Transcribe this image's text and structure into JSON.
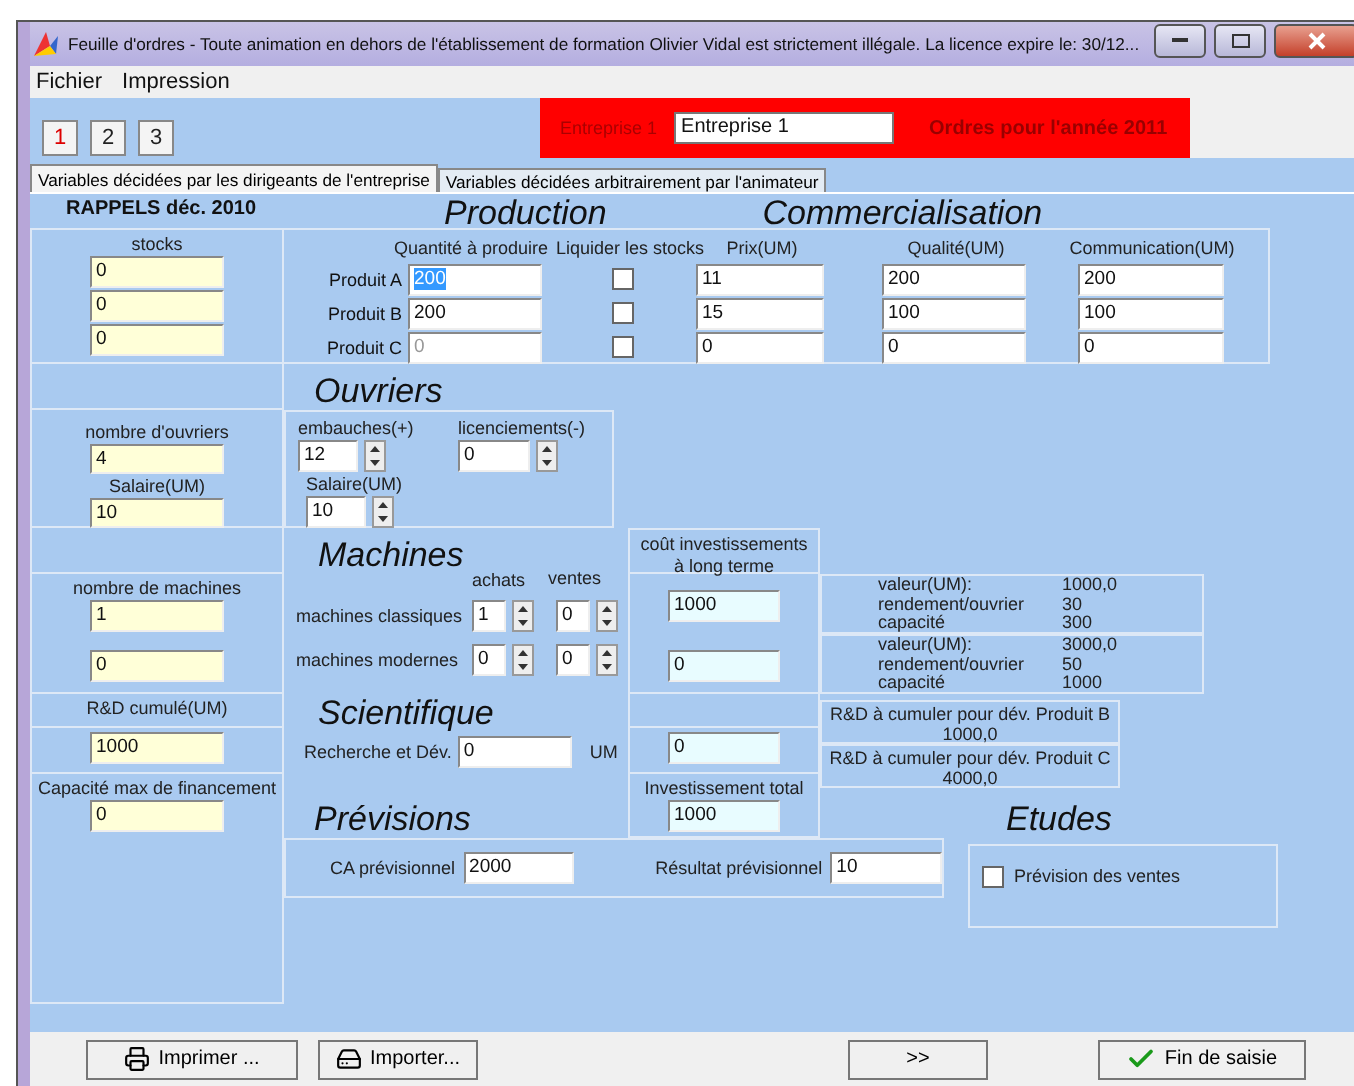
{
  "window": {
    "title": "Feuille d'ordres - Toute animation en dehors de l'établissement de formation Olivier Vidal est strictement illégale. La licence expire le: 30/12..."
  },
  "menu": [
    "Fichier",
    "Impression"
  ],
  "toolbar": {
    "buttons": [
      {
        "label": "1",
        "selected": true
      },
      {
        "label": "2",
        "selected": false
      },
      {
        "label": "3",
        "selected": false
      }
    ],
    "company_label": "Entreprise 1",
    "company_value": "Entreprise 1",
    "year_label": "Ordres pour l'année  2011"
  },
  "tabs": [
    {
      "label": "Variables décidées par les dirigeants de l'entreprise",
      "selected": true
    },
    {
      "label": "Variables décidées arbitrairement par l'animateur",
      "selected": false
    }
  ],
  "rappels": {
    "title": "RAPPELS déc. 2010",
    "stocks_label": "stocks",
    "stocks": [
      "0",
      "0",
      "0"
    ],
    "ouvriers_label": "nombre d'ouvriers",
    "ouvriers_value": "4",
    "salaire_label": "Salaire(UM)",
    "salaire_value": "10",
    "machines_label": "nombre de machines",
    "machines": [
      "1",
      "0"
    ],
    "rd_label": "R&D cumulé(UM)",
    "rd_value": "1000",
    "capacite_label": "Capacité max de financement",
    "capacite_value": "0"
  },
  "production": {
    "title": "Production",
    "quantity_header": "Quantité à produire",
    "liquidate_header": "Liquider les stocks",
    "rows": [
      {
        "product": "Produit A",
        "quantity": "200",
        "highlighted": true,
        "disabled": false,
        "liquidate": false,
        "price": "11",
        "quality": "200",
        "communication": "200"
      },
      {
        "product": "Produit B",
        "quantity": "200",
        "highlighted": false,
        "disabled": false,
        "liquidate": false,
        "price": "15",
        "quality": "100",
        "communication": "100"
      },
      {
        "product": "Produit C",
        "quantity": "0",
        "highlighted": false,
        "disabled": true,
        "liquidate": false,
        "price": "0",
        "quality": "0",
        "communication": "0"
      }
    ]
  },
  "commercialisation": {
    "title": "Commercialisation",
    "headers": [
      "Prix(UM)",
      "Qualité(UM)",
      "Communication(UM)"
    ]
  },
  "ouvriers": {
    "title": "Ouvriers",
    "embauches_label": "embauches(+)",
    "embauches_value": "12",
    "licenciements_label": "licenciements(-)",
    "licenciements_value": "0",
    "salaire_label": "Salaire(UM)",
    "salaire_value": "10"
  },
  "machines": {
    "title": "Machines",
    "achats_header": "achats",
    "ventes_header": "ventes",
    "cost_header": [
      "coût investissements",
      "à long terme"
    ],
    "rows": [
      {
        "label": "machines classiques",
        "achats": "1",
        "ventes": "0",
        "cost": "1000",
        "info": [
          {
            "label": "valeur(UM):",
            "value": "1000,0"
          },
          {
            "label": "rendement/ouvrier",
            "value": "30"
          },
          {
            "label": "capacité",
            "value": "300"
          }
        ]
      },
      {
        "label": "machines modernes",
        "achats": "0",
        "ventes": "0",
        "cost": "0",
        "info": [
          {
            "label": "valeur(UM):",
            "value": "3000,0"
          },
          {
            "label": "rendement/ouvrier",
            "value": "50"
          },
          {
            "label": "capacité",
            "value": "1000"
          }
        ]
      }
    ]
  },
  "scientifique": {
    "title": "Scientifique",
    "label": "Recherche et Dév.",
    "value": "0",
    "unit": "UM",
    "cost": "0",
    "targets": [
      {
        "label": "R&D à cumuler pour dév. Produit B",
        "value": "1000,0"
      },
      {
        "label": "R&D à cumuler pour dév. Produit C",
        "value": "4000,0"
      }
    ]
  },
  "investissement": {
    "label": "Investissement total",
    "value": "1000"
  },
  "previsions": {
    "title": "Prévisions",
    "ca_label": "CA prévisionnel",
    "ca_value": "2000",
    "resultat_label": "Résultat prévisionnel",
    "resultat_value": "10"
  },
  "etudes": {
    "title": "Etudes",
    "checkbox_label": "Prévision des ventes",
    "checked": false
  },
  "footer": [
    {
      "label": "Imprimer ...",
      "kind": "print"
    },
    {
      "label": "Importer...",
      "kind": "import"
    },
    {
      "label": ">>",
      "kind": "next"
    },
    {
      "label": "Fin de saisie",
      "kind": "finish"
    }
  ]
}
